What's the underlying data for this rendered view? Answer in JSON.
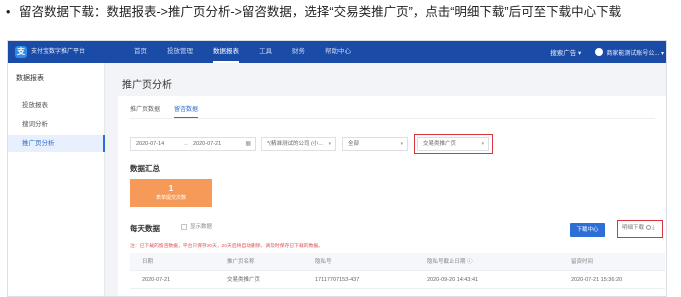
{
  "instruction": {
    "bullet": "•",
    "text": "留咨数据下载：数据报表->推广页分析->留咨数据，选择“交易类推广页”，点击“明细下载”后可至下载中心下载"
  },
  "colors": {
    "topbar": "#1a4ba6",
    "accent": "#2d6fd6",
    "summary_card": "#f59a58",
    "highlight": "#d9363e"
  },
  "topbar": {
    "logo_icon": "alipay-logo-icon",
    "logo_glyph": "支",
    "brand": "支付宝数字推广平台",
    "nav": [
      "首页",
      "投放管理",
      "数据报表",
      "工具",
      "财务",
      "帮助中心"
    ],
    "active_nav": 2,
    "ad_menu": "搜索广告 ▾",
    "user": "商家能测试账号公... ▾"
  },
  "sidebar": {
    "title": "数据报表",
    "items": [
      {
        "label": "投放报表"
      },
      {
        "label": "搜词分析"
      },
      {
        "label": "推广页分析"
      }
    ],
    "active": 2
  },
  "page": {
    "title": "推广页分析"
  },
  "tabs": [
    {
      "label": "推广页数据"
    },
    {
      "label": "留咨数据"
    }
  ],
  "active_tab": 1,
  "filters": {
    "date_start": "2020-07-14",
    "date_separator": "→",
    "date_end": "2020-07-21",
    "calendar_icon": "calendar-icon",
    "account": "*(精准测试的公司 (小...",
    "scope": "全部",
    "page_type": "交易类推广页"
  },
  "summary": {
    "title": "数据汇总",
    "value": "1",
    "label": "表单提交次数"
  },
  "daily": {
    "title": "每天数据",
    "show_number_label": "显示数据",
    "note": "注：已下载的留咨数据，平台只保存20天，20天后将自动删除，请及时保存已下载的数据。",
    "download_center_label": "下载中心",
    "detail_download_label": "明细下载"
  },
  "table": {
    "headers": [
      "日期",
      "推广页名称",
      "隐私号",
      "隐私号截止日期 ⓘ",
      "留资时间"
    ],
    "rows": [
      [
        "2020-07-21",
        "交易类推广页",
        "17117707153-437",
        "2020-09-20 14:43:41",
        "2020-07-21 15:36:20"
      ]
    ]
  }
}
